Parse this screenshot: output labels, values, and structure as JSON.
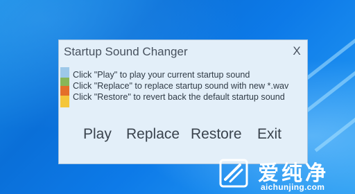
{
  "window": {
    "title": "Startup Sound Changer",
    "close_label": "X"
  },
  "info": {
    "lines": [
      "Click \"Play\" to play your current startup sound",
      "Click \"Replace\" to replace startup sound with new *.wav",
      "Click \"Restore\" to revert back the default startup sound"
    ],
    "bar_colors": [
      "#9dc8e9",
      "#88b658",
      "#e46f2a",
      "#f4c63a"
    ]
  },
  "buttons": {
    "play": "Play",
    "replace": "Replace",
    "restore": "Restore",
    "exit": "Exit"
  },
  "watermark": {
    "chinese": "爱纯净",
    "domain": "aichunjing.com"
  },
  "colors": {
    "desktop": "#0a6fd8",
    "window_bg": "#e3eff9",
    "text": "#2f3a45"
  }
}
